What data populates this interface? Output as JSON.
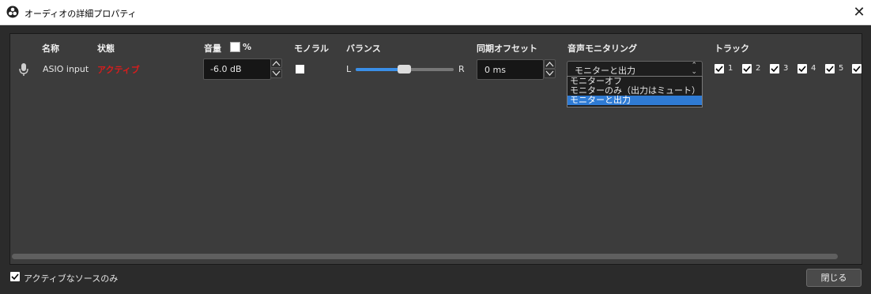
{
  "window": {
    "title": "オーディオの詳細プロパティ",
    "close_glyph": "✕"
  },
  "headers": {
    "name": "名称",
    "status": "状態",
    "volume": "音量",
    "percent": "%",
    "mono": "モノラル",
    "balance": "バランス",
    "sync_offset": "同期オフセット",
    "monitoring": "音声モニタリング",
    "tracks": "トラック"
  },
  "row": {
    "name": "ASIO input",
    "status": "アクティブ",
    "volume": "-6.0 dB",
    "mono_checked": false,
    "balance_left": "L",
    "balance_right": "R",
    "balance_value": 0.5,
    "sync_offset": "0 ms",
    "monitoring_selected": "モニターと出力",
    "tracks": [
      {
        "label": "1",
        "checked": true
      },
      {
        "label": "2",
        "checked": true
      },
      {
        "label": "3",
        "checked": true
      },
      {
        "label": "4",
        "checked": true
      },
      {
        "label": "5",
        "checked": true
      },
      {
        "label": "",
        "checked": true
      }
    ]
  },
  "dropdown": {
    "options": [
      "モニターオフ",
      "モニターのみ（出力はミュート）",
      "モニターと出力"
    ],
    "selected_index": 2
  },
  "footer": {
    "active_only_label": "アクティブなソースのみ",
    "active_only_checked": true,
    "close_button": "閉じる"
  },
  "colors": {
    "status_active": "#d91c1c",
    "accent": "#2f7bd4",
    "background": "#2b2b2b",
    "panel": "#3c3c3c"
  }
}
